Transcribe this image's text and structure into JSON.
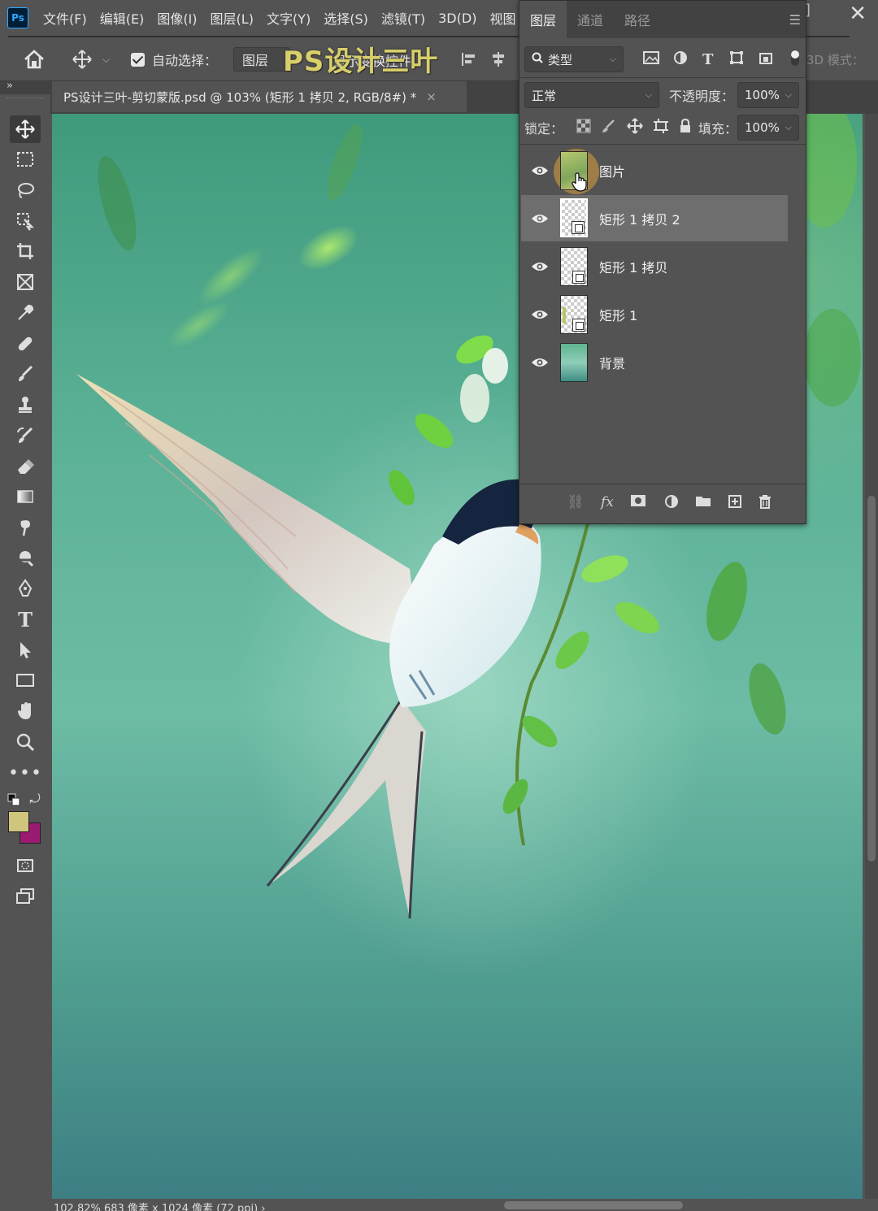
{
  "menubar": {
    "app_icon": "Ps",
    "items": [
      "文件(F)",
      "编辑(E)",
      "图像(I)",
      "图层(L)",
      "文字(Y)",
      "选择(S)",
      "滤镜(T)",
      "3D(D)",
      "视图"
    ],
    "close_glyph": "✕"
  },
  "options": {
    "auto_select_label": "自动选择：",
    "auto_select_target": "图层",
    "show_transform_label": "显示变换控件",
    "mode3d_label": "3D 模式："
  },
  "watermark": "PS设计三叶",
  "document": {
    "tab_title": "PS设计三叶-剪切蒙版.psd @ 103% (矩形 1 拷贝 2, RGB/8#) *",
    "tab_close": "×"
  },
  "status": {
    "text": "102.82%    683 像素 x 1024 像素 (72 ppi)    ›"
  },
  "layers_panel": {
    "tabs": [
      "图层",
      "通道",
      "路径"
    ],
    "filter_kind": "类型",
    "blend_mode": "正常",
    "opacity_label": "不透明度：",
    "opacity_value": "100%",
    "lock_label": "锁定：",
    "fill_label": "填充：",
    "fill_value": "100%",
    "layers": [
      {
        "name": "图片",
        "visible": true,
        "selected": false
      },
      {
        "name": "矩形 1 拷贝 2",
        "visible": true,
        "selected": true
      },
      {
        "name": "矩形 1 拷贝",
        "visible": true,
        "selected": false
      },
      {
        "name": "矩形 1",
        "visible": true,
        "selected": false
      },
      {
        "name": "背景",
        "visible": true,
        "selected": false
      }
    ]
  },
  "colors": {
    "foreground": "#cfc57c",
    "background": "#9b1b72",
    "panel_bg": "#535353",
    "selected_layer": "#6e6e6e"
  }
}
